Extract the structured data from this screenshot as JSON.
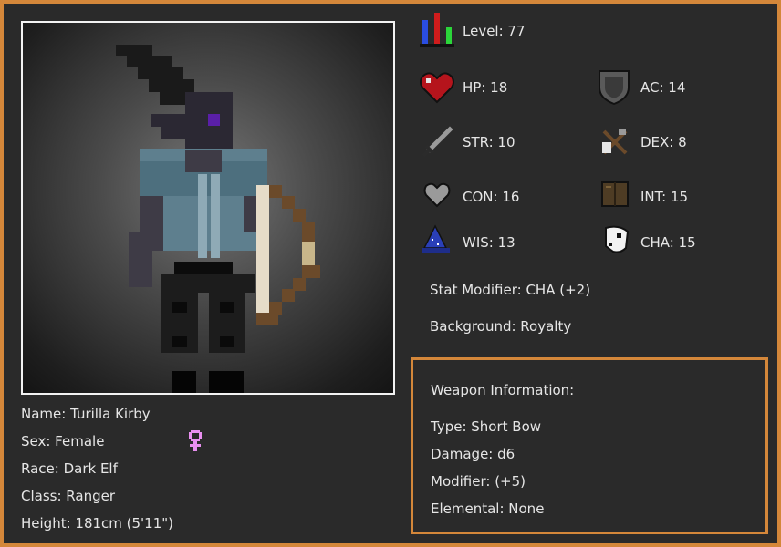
{
  "character": {
    "name": "Name: Turilla Kirby",
    "sex": "Sex: Female",
    "race": "Race: Dark Elf",
    "class": "Class: Ranger",
    "height": "Height: 181cm (5'11\")"
  },
  "stats": {
    "level": "Level: 77",
    "hp": "HP: 18",
    "ac": "AC: 14",
    "str": "STR: 10",
    "dex": "DEX: 8",
    "con": "CON: 16",
    "int": "INT: 15",
    "wis": "WIS: 13",
    "cha": "CHA: 15",
    "stat_modifier": "Stat Modifier: CHA (+2)",
    "background": "Background: Royalty"
  },
  "weapon": {
    "heading": "Weapon Information:",
    "type": "Type: Short Bow",
    "damage": "Damage: d6",
    "modifier": "Modifier: (+5)",
    "elemental": "Elemental: None"
  },
  "colors": {
    "frame_border": "#d4873a",
    "background": "#2a2a2a",
    "text": "#e6e6e6",
    "female_symbol": "#e98ff0"
  },
  "icons": {
    "level": "level-bars-icon",
    "hp": "heart-icon",
    "ac": "shield-icon",
    "str": "sword-icon",
    "dex": "crossed-daggers-icon",
    "con": "grey-heart-icon",
    "int": "book-icon",
    "wis": "wizard-hat-icon",
    "cha": "mask-icon",
    "sex": "female-symbol-icon"
  }
}
